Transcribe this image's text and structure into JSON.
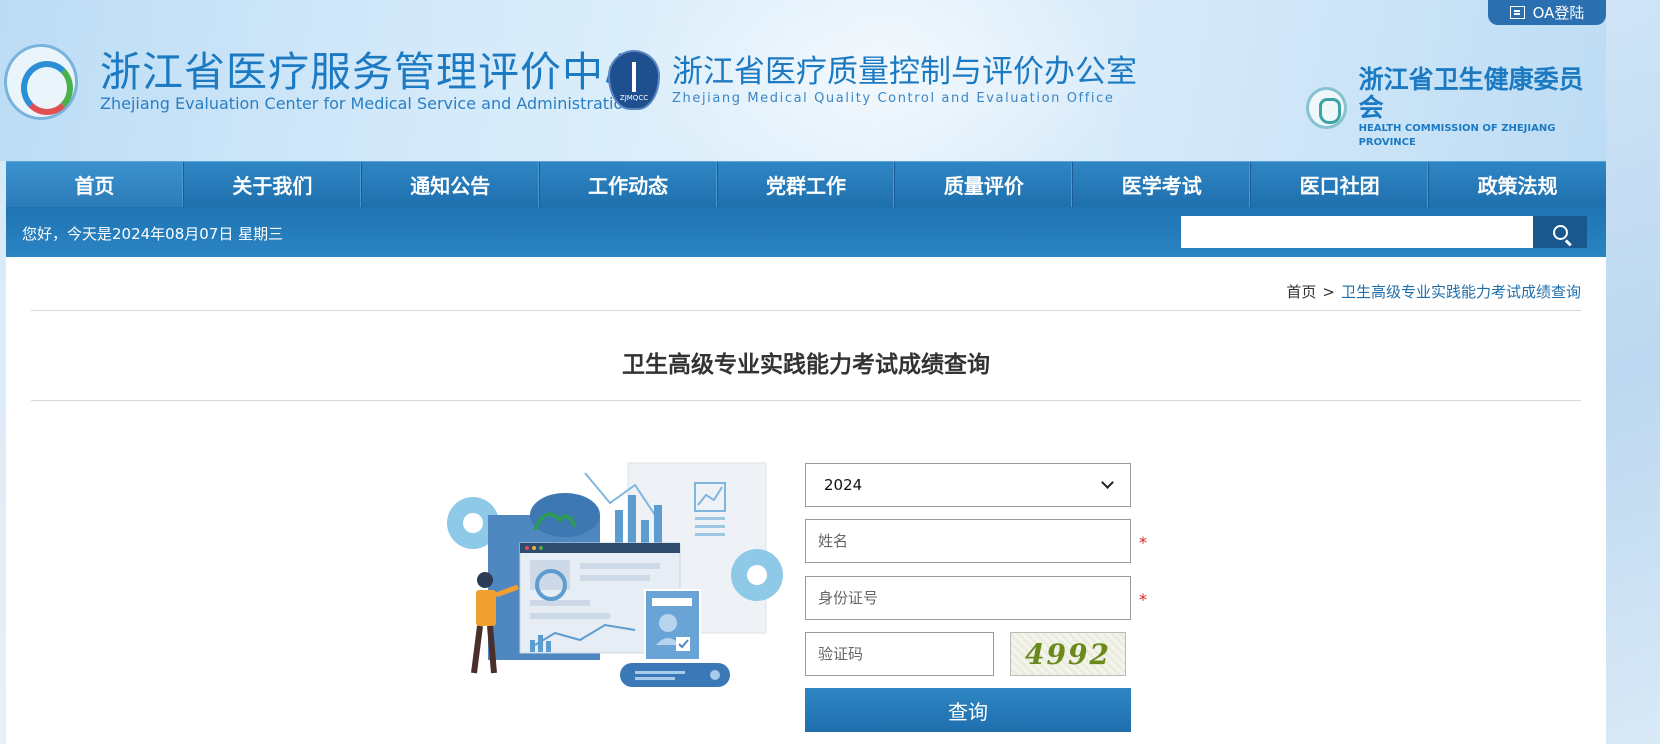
{
  "header": {
    "oa_login": "OA登陆",
    "org1": {
      "cn": "浙江省医疗服务管理评价中心",
      "en": "Zhejiang Evaluation Center for Medical Service and Administration"
    },
    "org2": {
      "cn": "浙江省医疗质量控制与评价办公室",
      "en": "Zhejiang Medical Quality Control and Evaluation Office"
    },
    "org3": {
      "cn": "浙江省卫生健康委员会",
      "en": "HEALTH COMMISSION OF ZHEJIANG PROVINCE"
    }
  },
  "nav": {
    "items": [
      "首页",
      "关于我们",
      "通知公告",
      "工作动态",
      "党群工作",
      "质量评价",
      "医学考试",
      "医口社团",
      "政策法规"
    ],
    "active_index": 0
  },
  "subbar": {
    "greeting": "您好，今天是2024年08月07日 星期三",
    "search_value": ""
  },
  "breadcrumb": {
    "home": "首页",
    "separator": ">",
    "current": "卫生高级专业实践能力考试成绩查询"
  },
  "page": {
    "title": "卫生高级专业实践能力考试成绩查询"
  },
  "form": {
    "year_selected": "2024",
    "name_placeholder": "姓名",
    "id_placeholder": "身份证号",
    "code_placeholder": "验证码",
    "captcha_text": "4992",
    "required_mark": "*",
    "submit_label": "查询"
  },
  "colors": {
    "primary": "#2f86c4",
    "primary_dark": "#1f6fad",
    "required": "#e02020",
    "link": "#1f6fad"
  }
}
